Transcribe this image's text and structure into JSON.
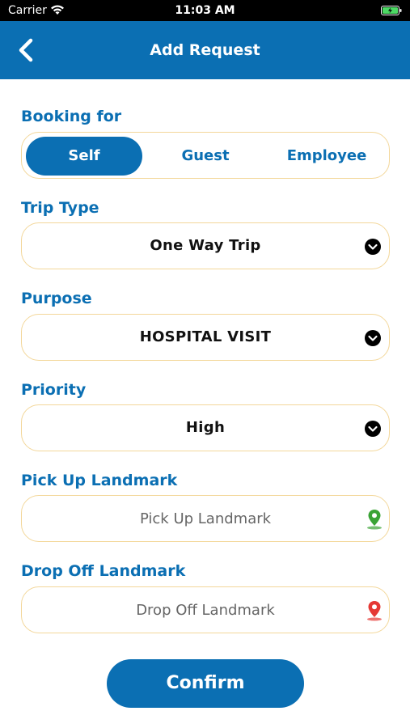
{
  "status_bar": {
    "carrier": "Carrier",
    "time": "11:03 AM"
  },
  "header": {
    "title": "Add Request"
  },
  "booking_for": {
    "label": "Booking for",
    "options": [
      "Self",
      "Guest",
      "Employee"
    ],
    "selected": "Self"
  },
  "trip_type": {
    "label": "Trip Type",
    "value": "One Way Trip"
  },
  "purpose": {
    "label": "Purpose",
    "value": "HOSPITAL VISIT"
  },
  "priority": {
    "label": "Priority",
    "value": "High"
  },
  "pickup": {
    "label": "Pick Up Landmark",
    "placeholder": "Pick Up Landmark"
  },
  "dropoff": {
    "label": "Drop Off Landmark",
    "placeholder": "Drop Off Landmark"
  },
  "confirm_label": "Confirm",
  "colors": {
    "primary": "#0b6fb3",
    "field_border": "#f3d79a",
    "pickup_pin": "#3aa335",
    "dropoff_pin": "#e53935"
  }
}
